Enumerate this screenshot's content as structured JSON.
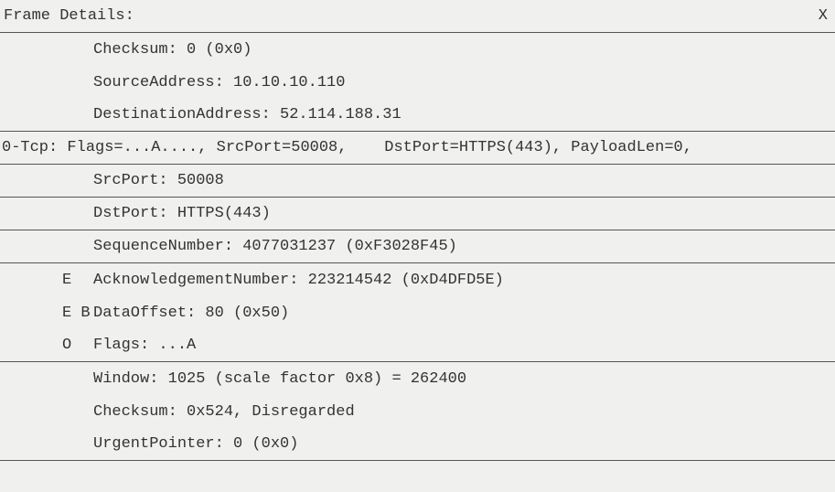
{
  "header": {
    "title": "Frame Details:",
    "close": "X"
  },
  "ip": {
    "checksum": "Checksum: 0 (0x0)",
    "src": "SourceAddress: 10.10.10.110",
    "dst": "DestinationAddress: 52.114.188.31"
  },
  "tcp_summary": "0-Tcp: Flags=...A...., SrcPort=50008,    DstPort=HTTPS(443), PayloadLen=0,",
  "tcp": {
    "srcport": "SrcPort: 50008",
    "dstport": "DstPort: HTTPS(443)",
    "seq": "SequenceNumber: 4077031237 (0xF3028F45)",
    "ack_marker": "E",
    "ack": "AcknowledgementNumber: 223214542 (0xD4DFD5E)",
    "dataoffset_marker": "E B",
    "dataoffset": "DataOffset: 80 (0x50)",
    "flags_marker": "O",
    "flags": "Flags: ...A",
    "window": "Window: 1025 (scale factor 0x8) = 262400",
    "checksum": "Checksum: 0x524, Disregarded",
    "urgent": "UrgentPointer: 0 (0x0)"
  }
}
